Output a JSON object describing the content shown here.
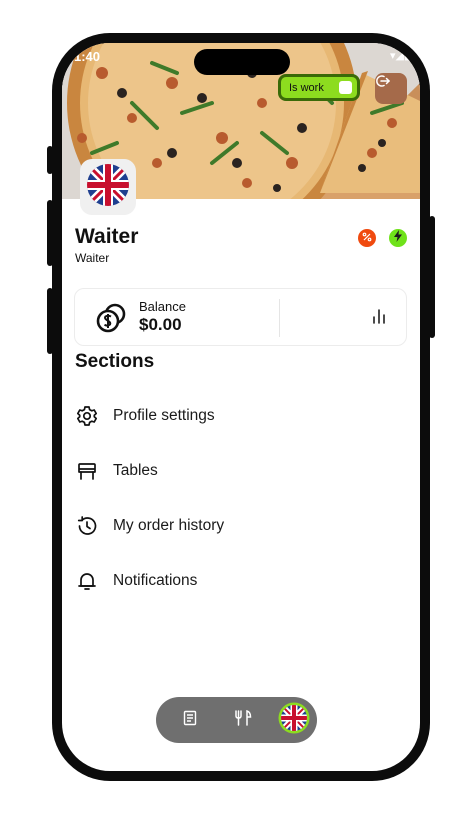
{
  "status_bar": {
    "time": "1:40",
    "signal": "▾◢▮"
  },
  "header": {
    "work_toggle": {
      "label": "Is work",
      "on": true
    },
    "logout": {
      "icon": "logout-icon"
    },
    "avatar": {
      "icon": "uk-flag-icon"
    }
  },
  "profile": {
    "name": "Waiter",
    "role": "Waiter",
    "badges": [
      {
        "icon": "percent-icon",
        "color": "#f04a0f"
      },
      {
        "icon": "lightning-icon",
        "color": "#6fe21a"
      }
    ]
  },
  "balance": {
    "label": "Balance",
    "value": "$0.00",
    "icon": "coins-icon",
    "stats_icon": "bar-chart-icon"
  },
  "sections": {
    "title": "Sections",
    "items": [
      {
        "label": "Profile settings",
        "icon": "gear-icon"
      },
      {
        "label": "Tables",
        "icon": "table-icon"
      },
      {
        "label": "My order history",
        "icon": "history-icon"
      },
      {
        "label": "Notifications",
        "icon": "bell-icon"
      }
    ]
  },
  "bottom_nav": {
    "items": [
      {
        "icon": "document-icon"
      },
      {
        "icon": "fork-knife-icon"
      },
      {
        "icon": "uk-flag-icon",
        "active": true
      }
    ]
  },
  "colors": {
    "toggle_bg": "#8ddc1f",
    "toggle_border": "#3a6a08",
    "logout_bg": "#a56a4a",
    "nav_bg": "#6f6f6f"
  }
}
